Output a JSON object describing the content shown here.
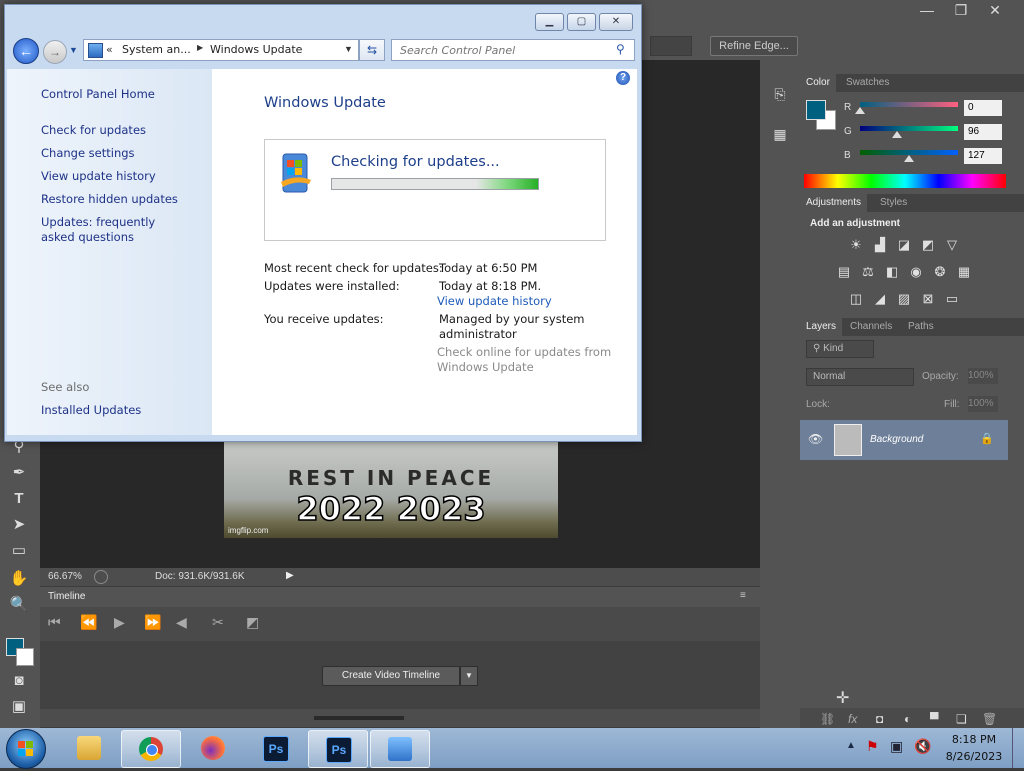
{
  "photoshop": {
    "refine_edge": "Refine Edge...",
    "zoom": "66.67%",
    "doc_info": "Doc: 931.6K/931.6K",
    "timeline_title": "Timeline",
    "create_video_timeline": "Create Video Timeline",
    "image": {
      "rest_in_peace": "REST IN PEACE",
      "years": "2022 2023",
      "watermark": "imgflip.com"
    },
    "color_panel": {
      "tabs": [
        "Color",
        "Swatches"
      ],
      "channels": [
        {
          "label": "R",
          "value": "0",
          "fraction": 0.0
        },
        {
          "label": "G",
          "value": "96",
          "fraction": 0.376
        },
        {
          "label": "B",
          "value": "127",
          "fraction": 0.498
        }
      ],
      "foreground": "#00607f"
    },
    "adjustments_panel": {
      "tabs": [
        "Adjustments",
        "Styles"
      ],
      "heading": "Add an adjustment"
    },
    "layers_panel": {
      "tabs": [
        "Layers",
        "Channels",
        "Paths"
      ],
      "kind": "Kind",
      "blend_mode": "Normal",
      "opacity_label": "Opacity:",
      "opacity_value": "100%",
      "lock_label": "Lock:",
      "fill_label": "Fill:",
      "fill_value": "100%",
      "layer_name": "Background"
    }
  },
  "windows_update": {
    "address": {
      "prefix": "«",
      "crumb1": "System an...",
      "crumb2": "Windows Update"
    },
    "search_placeholder": "Search Control Panel",
    "sidebar": {
      "home": "Control Panel Home",
      "links": [
        "Check for updates",
        "Change settings",
        "View update history",
        "Restore hidden updates",
        "Updates: frequently asked questions"
      ],
      "see_also": "See also",
      "installed_updates": "Installed Updates"
    },
    "title": "Windows Update",
    "status": "Checking for updates...",
    "progress": 0.3,
    "info": {
      "recent_check_label": "Most recent check for updates:",
      "recent_check_value": "Today at 6:50 PM",
      "installed_label": "Updates were installed:",
      "installed_value": "Today at 8:18 PM.",
      "history_link": "View update history",
      "receive_label": "You receive updates:",
      "receive_value": "Managed by your system administrator",
      "check_online": "Check online for updates from Windows Update"
    }
  },
  "taskbar": {
    "time": "8:18 PM",
    "date": "8/26/2023",
    "items": [
      "explorer",
      "chrome",
      "firefox",
      "photoshop-1",
      "photoshop-2",
      "control-panel"
    ],
    "ps_label": "Ps"
  }
}
